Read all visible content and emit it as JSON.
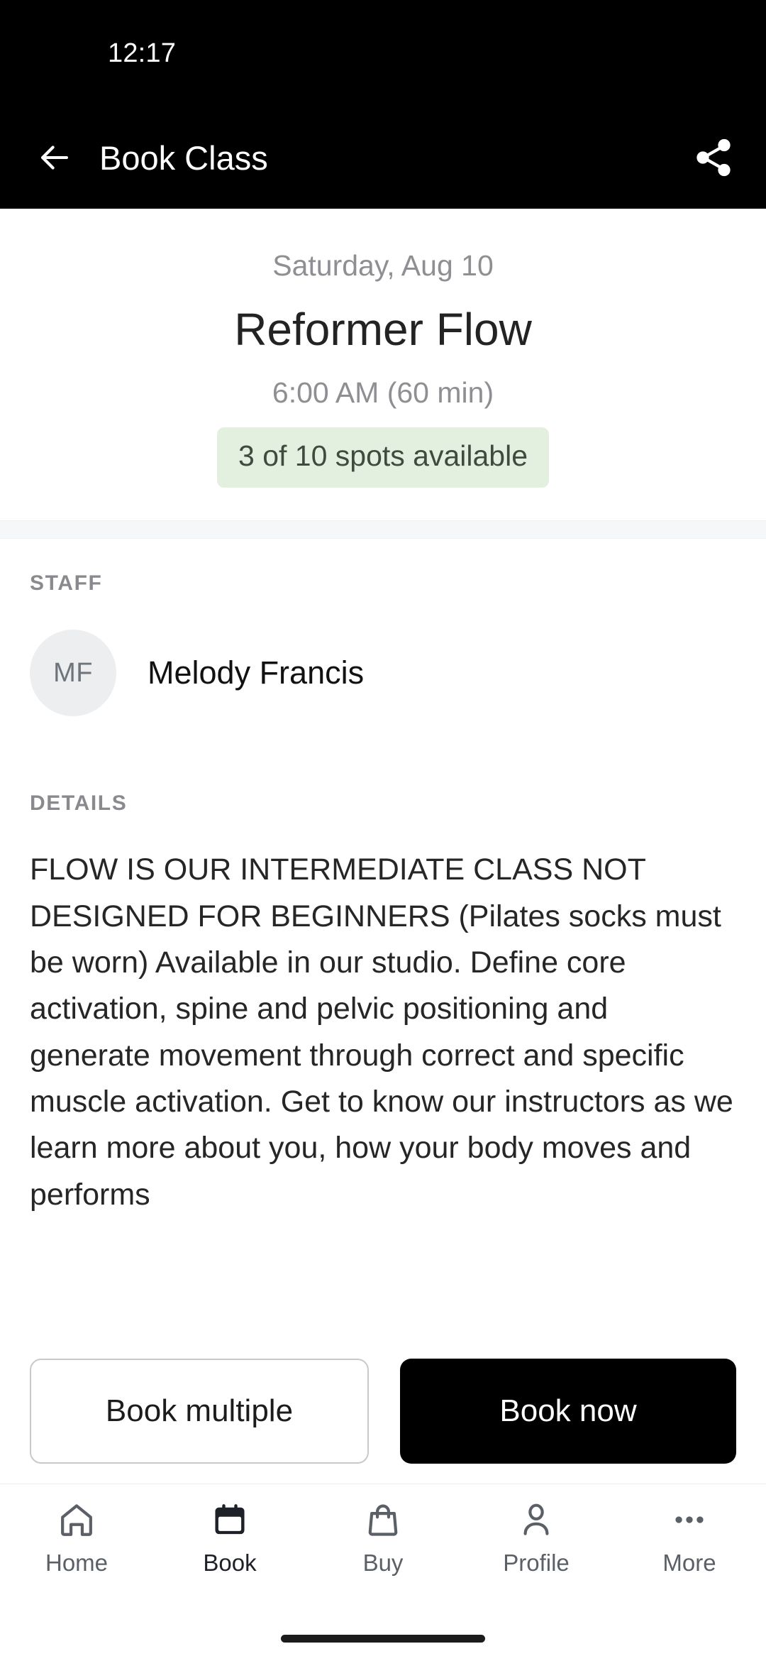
{
  "status_bar": {
    "time": "12:17"
  },
  "app_bar": {
    "title": "Book Class",
    "back_icon": "arrow-left-icon",
    "share_icon": "share-icon"
  },
  "hero": {
    "date": "Saturday, Aug 10",
    "class_name": "Reformer Flow",
    "time": "6:00 AM (60 min)",
    "availability": "3 of 10 spots available",
    "availability_bg": "#e3f0e0",
    "availability_text_color": "#3e4b3e"
  },
  "staff": {
    "section_label": "STAFF",
    "avatar_initials": "MF",
    "name": "Melody Francis"
  },
  "details": {
    "section_label": "DETAILS",
    "text": "FLOW IS OUR INTERMEDIATE CLASS NOT DESIGNED FOR BEGINNERS (Pilates socks must be worn) Available in our studio. Define core activation, spine and pelvic positioning and generate movement through correct and specific muscle activation. Get to know our instructors as we learn more about you, how your body moves and performs"
  },
  "actions": {
    "secondary_label": "Book multiple",
    "primary_label": "Book now",
    "primary_bg": "#000000",
    "primary_text_color": "#ffffff"
  },
  "bottom_nav": {
    "items": [
      {
        "label": "Home",
        "icon": "home-icon",
        "active": false
      },
      {
        "label": "Book",
        "icon": "calendar-icon",
        "active": true
      },
      {
        "label": "Buy",
        "icon": "shopping-bag-icon",
        "active": false
      },
      {
        "label": "Profile",
        "icon": "person-icon",
        "active": false
      },
      {
        "label": "More",
        "icon": "ellipsis-icon",
        "active": false
      }
    ]
  }
}
